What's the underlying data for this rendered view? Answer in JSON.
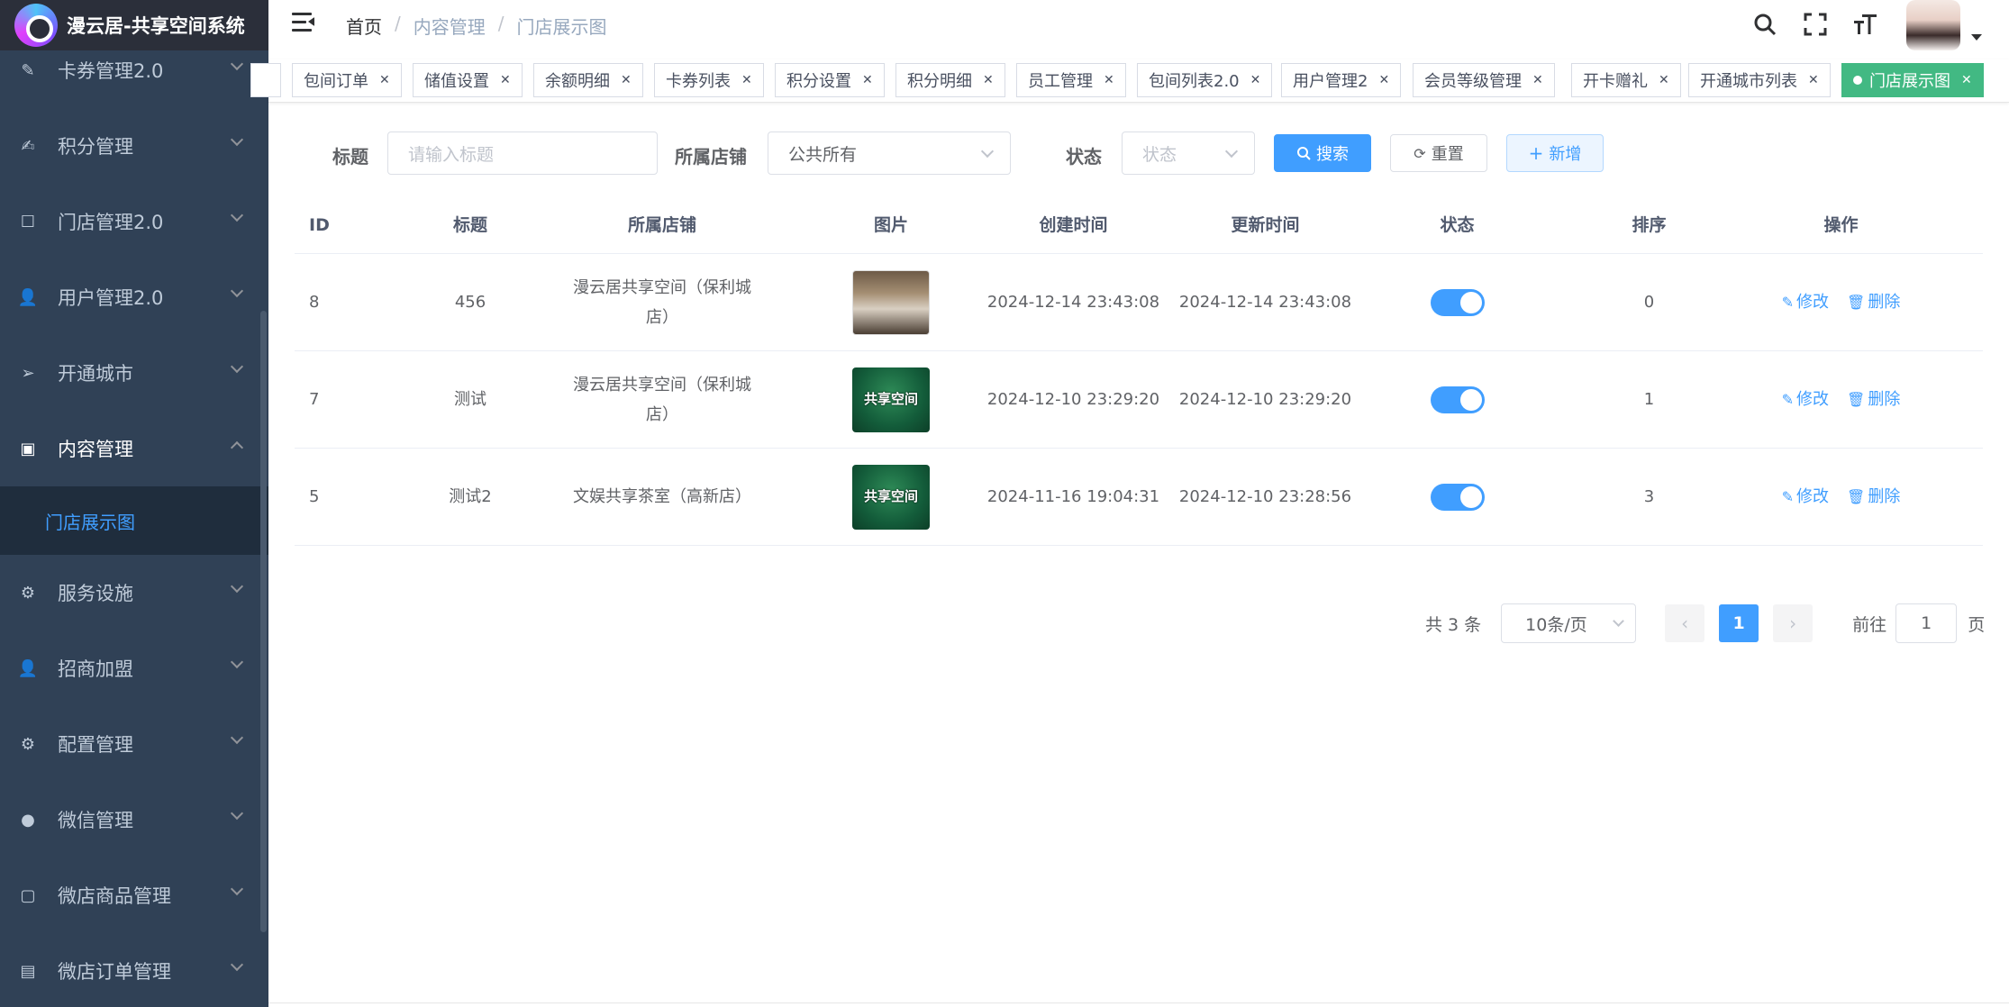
{
  "app": {
    "title": "漫云居-共享空间系统"
  },
  "sidebar": {
    "items": [
      {
        "label": "卡券管理2.0",
        "icon": "ticket-icon"
      },
      {
        "label": "积分管理",
        "icon": "edit-icon"
      },
      {
        "label": "门店管理2.0",
        "icon": "store-icon"
      },
      {
        "label": "用户管理2.0",
        "icon": "user-icon"
      },
      {
        "label": "开通城市",
        "icon": "send-icon"
      },
      {
        "label": "内容管理",
        "icon": "picture-icon",
        "expanded": true
      },
      {
        "label": "服务设施",
        "icon": "gear-icon"
      },
      {
        "label": "招商加盟",
        "icon": "user-icon"
      },
      {
        "label": "配置管理",
        "icon": "gear-icon"
      },
      {
        "label": "微信管理",
        "icon": "wechat-icon"
      },
      {
        "label": "微店商品管理",
        "icon": "bag-icon"
      },
      {
        "label": "微店订单管理",
        "icon": "document-icon"
      }
    ],
    "active_subitem": "门店展示图"
  },
  "header": {
    "breadcrumb": [
      "首页",
      "内容管理",
      "门店展示图"
    ]
  },
  "tags": [
    {
      "label": "包间订单"
    },
    {
      "label": "储值设置"
    },
    {
      "label": "余额明细"
    },
    {
      "label": "卡券列表"
    },
    {
      "label": "积分设置"
    },
    {
      "label": "积分明细"
    },
    {
      "label": "员工管理"
    },
    {
      "label": "包间列表2.0"
    },
    {
      "label": "用户管理2"
    },
    {
      "label": "会员等级管理"
    },
    {
      "label": "开卡赠礼"
    },
    {
      "label": "开通城市列表"
    },
    {
      "label": "门店展示图",
      "active": true
    }
  ],
  "filter": {
    "title_label": "标题",
    "title_placeholder": "请输入标题",
    "store_label": "所属店铺",
    "store_value": "公共所有",
    "status_label": "状态",
    "status_placeholder": "状态",
    "search_label": "搜索",
    "reset_label": "重置",
    "add_label": "新增"
  },
  "table": {
    "columns": [
      "ID",
      "标题",
      "所属店铺",
      "图片",
      "创建时间",
      "更新时间",
      "状态",
      "排序",
      "操作"
    ],
    "rows": [
      {
        "id": "8",
        "title": "456",
        "store": "漫云居共享空间（保利城店）",
        "image": "room",
        "created": "2024-12-14 23:43:08",
        "updated": "2024-12-14 23:43:08",
        "status": true,
        "sort": "0"
      },
      {
        "id": "7",
        "title": "测试",
        "store": "漫云居共享空间（保利城店）",
        "image": "green",
        "image_text": "共享空间",
        "created": "2024-12-10 23:29:20",
        "updated": "2024-12-10 23:29:20",
        "status": true,
        "sort": "1"
      },
      {
        "id": "5",
        "title": "测试2",
        "store": "文娱共享茶室（高新店）",
        "image": "green",
        "image_text": "共享空间",
        "created": "2024-11-16 19:04:31",
        "updated": "2024-12-10 23:28:56",
        "status": true,
        "sort": "3"
      }
    ],
    "edit_label": "修改",
    "delete_label": "删除"
  },
  "pagination": {
    "total": "共 3 条",
    "page_size": "10条/页",
    "current": "1",
    "goto_label": "前往",
    "goto_value": "1",
    "goto_suffix": "页"
  },
  "colors": {
    "primary": "#409eff",
    "sidebar_bg": "#304156",
    "active_tag": "#42b983"
  }
}
